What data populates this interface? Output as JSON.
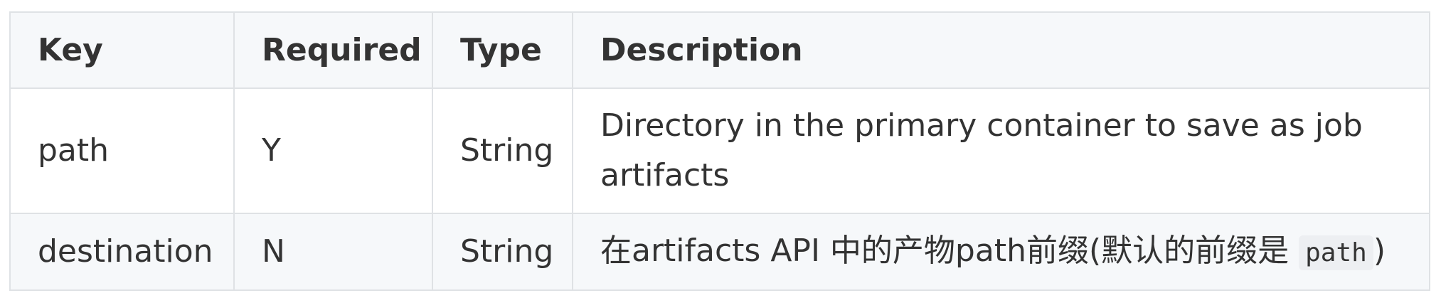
{
  "table": {
    "headers": [
      "Key",
      "Required",
      "Type",
      "Description"
    ],
    "rows": [
      {
        "key": "path",
        "required": "Y",
        "type": "String",
        "description": "Directory in the primary container to save as job artifacts"
      },
      {
        "key": "destination",
        "required": "N",
        "type": "String",
        "description_prefix": "在artifacts API 中的产物path前缀(默认的前缀是 ",
        "description_code": "path",
        "description_suffix": ")"
      }
    ]
  }
}
